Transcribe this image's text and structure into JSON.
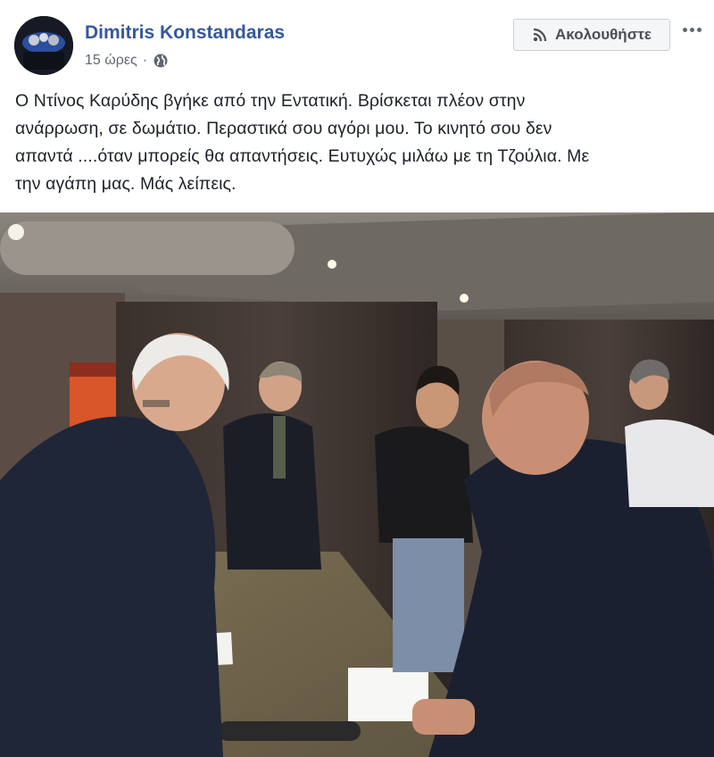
{
  "post": {
    "author": "Dimitris Konstandaras",
    "time": "15 ώρες",
    "separator": "·",
    "privacy_icon": "globe-icon",
    "follow_label": "Ακολουθήστε",
    "follow_icon": "rss-icon",
    "more_icon": "more-dots-icon",
    "text_lines": [
      "Ο Ντίνος Καρύδης βγήκε από την Εντατική. Βρίσκεται πλέον στην",
      "ανάρρωση, σε δωμάτιο. Περαστικά σου αγόρι μου. Το κινητό σου δεν",
      "απαντά ....όταν μπορείς θα απαντήσεις. Ευτυχώς μιλάω με τη Τζούλια. Με",
      "την αγάπη μας. Μάς λείπεις."
    ]
  },
  "colors": {
    "author_link": "#365899",
    "meta_text": "#616770",
    "body_text": "#1d2129",
    "button_bg": "#f5f6f7",
    "button_border": "#ccd0d5"
  }
}
